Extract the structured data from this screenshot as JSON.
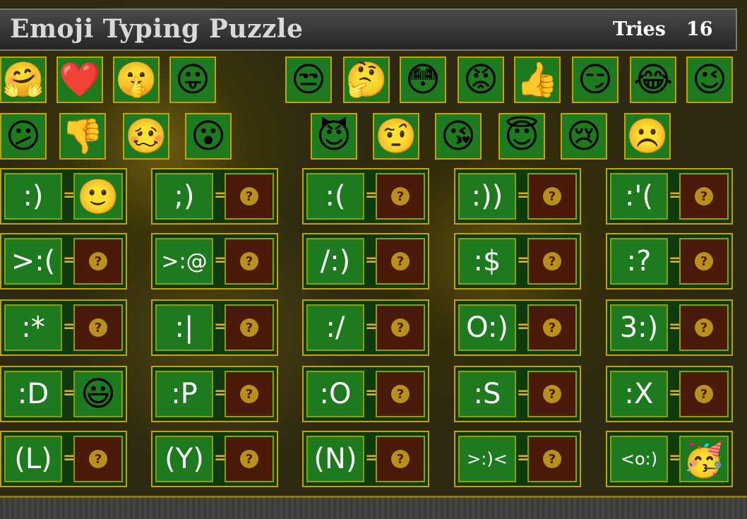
{
  "header": {
    "title": "Emoji Typing Puzzle",
    "tries_label": "Tries",
    "tries_value": "16"
  },
  "palette_row1": [
    "🤗",
    "❤️",
    "🤫",
    "😛",
    "😒",
    "🤔",
    "😳",
    "😡",
    "👍",
    "😏",
    "😂",
    "😉"
  ],
  "palette_row2": [
    "😕",
    "👎",
    "🥴",
    "😮",
    "😈",
    "🤨",
    "😘",
    "😇",
    "😢",
    "☹️"
  ],
  "equations": [
    [
      {
        "code": ":)",
        "answer": "🙂"
      },
      {
        "code": ";)",
        "answer": ""
      },
      {
        "code": ":(",
        "answer": ""
      },
      {
        "code": ":))",
        "answer": ""
      },
      {
        "code": ":'(",
        "answer": ""
      }
    ],
    [
      {
        "code": ">:(",
        "answer": ""
      },
      {
        "code": ">:@",
        "answer": ""
      },
      {
        "code": "/:)",
        "answer": ""
      },
      {
        "code": ":$",
        "answer": ""
      },
      {
        "code": ":?",
        "answer": ""
      }
    ],
    [
      {
        "code": ":*",
        "answer": ""
      },
      {
        "code": ":|",
        "answer": ""
      },
      {
        "code": ":/",
        "answer": ""
      },
      {
        "code": "O:)",
        "answer": ""
      },
      {
        "code": "3:)",
        "answer": ""
      }
    ],
    [
      {
        "code": ":D",
        "answer": "😃"
      },
      {
        "code": ":P",
        "answer": ""
      },
      {
        "code": ":O",
        "answer": ""
      },
      {
        "code": ":S",
        "answer": ""
      },
      {
        "code": ":X",
        "answer": ""
      }
    ],
    [
      {
        "code": "(L)",
        "answer": ""
      },
      {
        "code": "(Y)",
        "answer": ""
      },
      {
        "code": "(N)",
        "answer": ""
      },
      {
        "code": ">:)<",
        "answer": ""
      },
      {
        "code": "<o:)",
        "answer": "🥳"
      }
    ]
  ],
  "equals_sign": "=",
  "unknown_mark": "?"
}
